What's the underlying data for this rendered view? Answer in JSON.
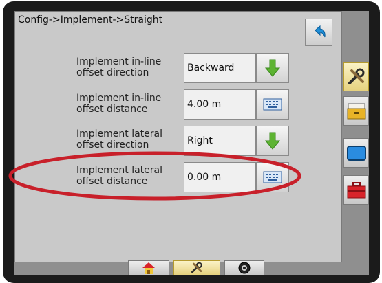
{
  "header": {
    "breadcrumb": "Config->Implement->Straight"
  },
  "rows": [
    {
      "label": "Implement in-line offset direction",
      "value": "Backward",
      "action": "down-arrow-icon"
    },
    {
      "label": "Implement in-line offset distance",
      "value": "4.00 m",
      "action": "keyboard-icon"
    },
    {
      "label": "Implement lateral offset direction",
      "value": "Right",
      "action": "down-arrow-icon"
    },
    {
      "label": "Implement lateral offset distance",
      "value": "0.00 m",
      "action": "keyboard-icon"
    }
  ],
  "side_tabs": [
    "tools-icon",
    "storage-box-icon",
    "display-icon",
    "toolbox-icon"
  ],
  "bottom_tabs": [
    "home-icon",
    "tools-icon",
    "camera-icon"
  ],
  "colors": {
    "accent": "#e6d27f",
    "highlight": "#c8202a",
    "arrow": "#5db332"
  }
}
